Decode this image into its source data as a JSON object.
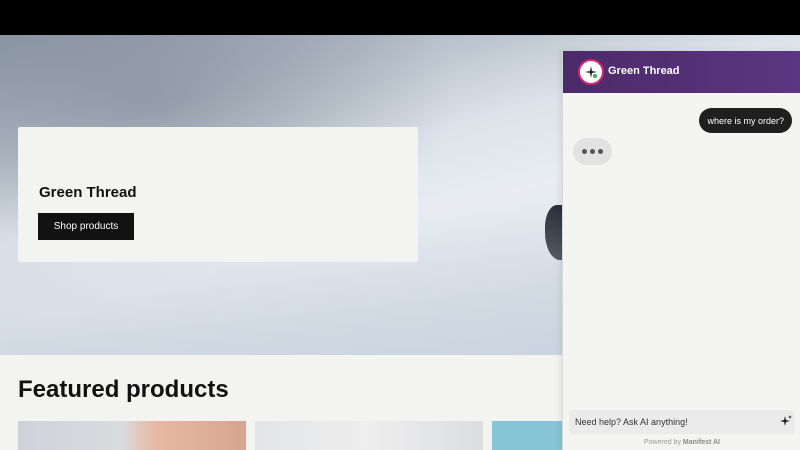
{
  "hero": {
    "title": "Green Thread",
    "shop_button_label": "Shop products"
  },
  "featured": {
    "title": "Featured products"
  },
  "chat": {
    "brand_name": "Green Thread",
    "user_message": "where is my order?",
    "input_placeholder": "Need help? Ask AI anything!",
    "powered_prefix": "Powered by ",
    "powered_brand": "Manifest AI",
    "header_color": "#4b2a6a",
    "avatar_ring_color": "#d6246e",
    "icons": [
      "sparkle-icon",
      "typing-indicator"
    ]
  }
}
